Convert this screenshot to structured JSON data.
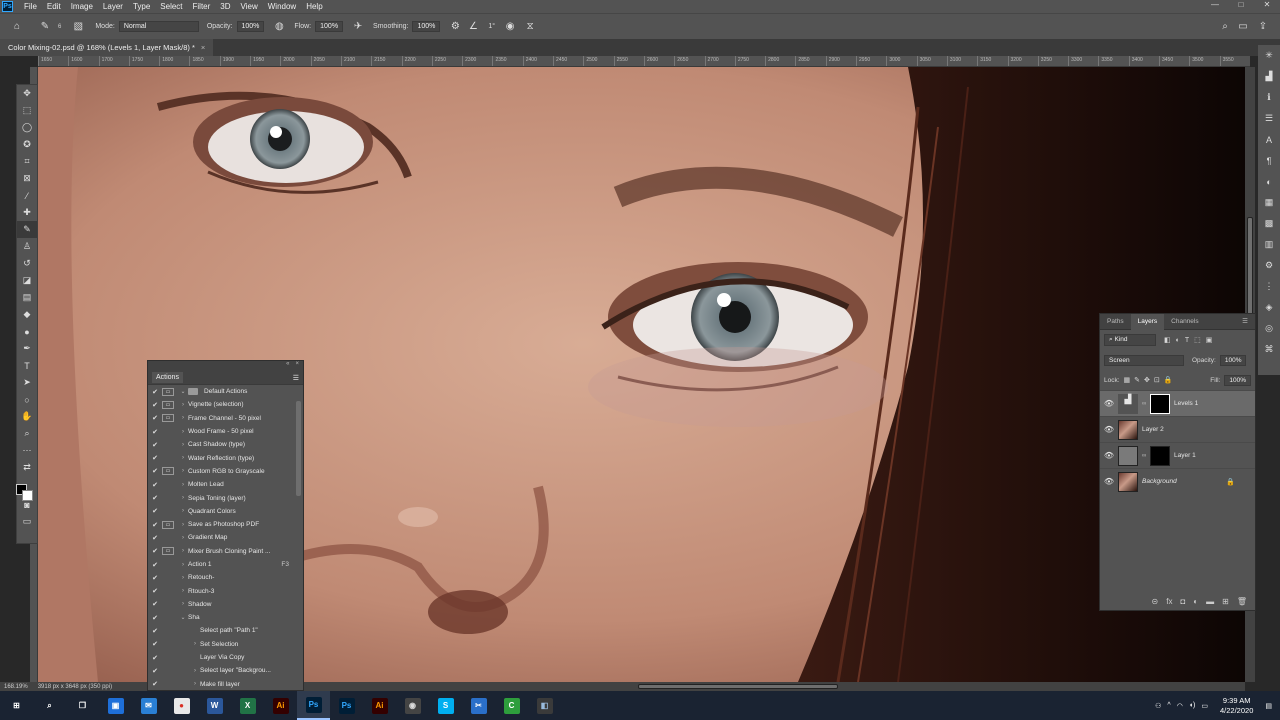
{
  "menubar": {
    "logo": "Ps",
    "items": [
      "File",
      "Edit",
      "Image",
      "Layer",
      "Type",
      "Select",
      "Filter",
      "3D",
      "View",
      "Window",
      "Help"
    ],
    "window_controls": [
      "—",
      "□",
      "✕"
    ]
  },
  "options": {
    "mode_label": "Mode:",
    "mode_value": "Normal",
    "opacity_label": "Opacity:",
    "opacity_value": "100%",
    "flow_label": "Flow:",
    "flow_value": "100%",
    "smoothing_label": "Smoothing:",
    "smoothing_value": "100%",
    "angle_value": "1°",
    "brush_size": "6"
  },
  "document": {
    "tab_title": "Color Mixing-02.psd @ 168% (Levels 1, Layer Mask/8) *",
    "close": "×"
  },
  "ruler_ticks": [
    "1650",
    "1600",
    "1700",
    "1750",
    "1800",
    "1850",
    "1900",
    "1950",
    "2000",
    "2050",
    "2100",
    "2150",
    "2200",
    "2250",
    "2300",
    "2350",
    "2400",
    "2450",
    "2500",
    "2550",
    "2600",
    "2650",
    "2700",
    "2750",
    "2800",
    "2850",
    "2900",
    "2950",
    "3000",
    "3050",
    "3100",
    "3150",
    "3200",
    "3250",
    "3300",
    "3350",
    "3400",
    "3450",
    "3500",
    "3550"
  ],
  "status": {
    "zoom": "168.19%",
    "doc_size": "3918 px x 3648 px (350 ppi)"
  },
  "actions_panel": {
    "title": "Actions",
    "rows": [
      {
        "label": "Default Actions",
        "dialog": true,
        "folder": true,
        "level": 0,
        "key": ""
      },
      {
        "label": "Vignette (selection)",
        "dialog": true,
        "level": 1,
        "key": ""
      },
      {
        "label": "Frame Channel - 50 pixel",
        "dialog": true,
        "level": 1,
        "key": ""
      },
      {
        "label": "Wood Frame - 50 pixel",
        "dialog": false,
        "level": 1,
        "key": ""
      },
      {
        "label": "Cast Shadow (type)",
        "dialog": false,
        "level": 1,
        "key": ""
      },
      {
        "label": "Water Reflection (type)",
        "dialog": false,
        "level": 1,
        "key": ""
      },
      {
        "label": "Custom RGB to Grayscale",
        "dialog": true,
        "level": 1,
        "key": ""
      },
      {
        "label": "Molten Lead",
        "dialog": false,
        "level": 1,
        "key": ""
      },
      {
        "label": "Sepia Toning (layer)",
        "dialog": false,
        "level": 1,
        "key": ""
      },
      {
        "label": "Quadrant Colors",
        "dialog": false,
        "level": 1,
        "key": ""
      },
      {
        "label": "Save as Photoshop PDF",
        "dialog": true,
        "level": 1,
        "key": ""
      },
      {
        "label": "Gradient Map",
        "dialog": false,
        "level": 1,
        "key": ""
      },
      {
        "label": "Mixer Brush Cloning Paint ...",
        "dialog": true,
        "level": 1,
        "key": ""
      },
      {
        "label": "Action 1",
        "dialog": false,
        "level": 1,
        "key": "F3"
      },
      {
        "label": "Retouch-",
        "dialog": false,
        "level": 1,
        "key": ""
      },
      {
        "label": "Rtouch-3",
        "dialog": false,
        "level": 1,
        "key": ""
      },
      {
        "label": "Shadow",
        "dialog": false,
        "level": 1,
        "key": ""
      },
      {
        "label": "Sha",
        "dialog": false,
        "level": 1,
        "key": "",
        "open": true
      },
      {
        "label": "Select path \"Path 1\"",
        "dialog": false,
        "level": 2,
        "key": "",
        "leaf": true
      },
      {
        "label": "Set Selection",
        "dialog": false,
        "level": 2,
        "key": ""
      },
      {
        "label": "Layer Via Copy",
        "dialog": false,
        "level": 2,
        "key": "",
        "leaf": true
      },
      {
        "label": "Select layer \"Backgrou...",
        "dialog": false,
        "level": 2,
        "key": ""
      },
      {
        "label": "Make fill layer",
        "dialog": false,
        "level": 2,
        "key": ""
      }
    ]
  },
  "layers_panel": {
    "tabs": [
      "Paths",
      "Layers",
      "Channels"
    ],
    "active_tab": "Layers",
    "filter": "Kind",
    "blend_mode": "Screen",
    "opacity_label": "Opacity:",
    "opacity_value": "100%",
    "lock_label": "Lock:",
    "fill_label": "Fill:",
    "fill_value": "100%",
    "layers": [
      {
        "name": "Levels 1",
        "kind": "adjustment",
        "active": true,
        "italic": false
      },
      {
        "name": "Layer 2",
        "kind": "photo",
        "active": false,
        "italic": false
      },
      {
        "name": "Layer 1",
        "kind": "gray-mask",
        "active": false,
        "italic": false
      },
      {
        "name": "Background",
        "kind": "photo",
        "active": false,
        "italic": true,
        "locked": true
      }
    ]
  },
  "taskbar": {
    "time": "9:39 AM",
    "date": "4/22/2020",
    "apps": [
      {
        "name": "start",
        "label": "⊞",
        "color": "#1a2332",
        "fg": "#fff"
      },
      {
        "name": "search",
        "label": "⌕",
        "color": "#1a2332",
        "fg": "#fff"
      },
      {
        "name": "task-view",
        "label": "❐",
        "color": "#1a2332",
        "fg": "#fff"
      },
      {
        "name": "store",
        "label": "▣",
        "color": "#1e6fd9",
        "fg": "#fff"
      },
      {
        "name": "mail",
        "label": "✉",
        "color": "#2a7fd4",
        "fg": "#fff"
      },
      {
        "name": "chrome",
        "label": "●",
        "color": "#e8e8e8",
        "fg": "#d93025"
      },
      {
        "name": "word",
        "label": "W",
        "color": "#2b579a",
        "fg": "#fff"
      },
      {
        "name": "excel",
        "label": "X",
        "color": "#217346",
        "fg": "#fff"
      },
      {
        "name": "illustrator",
        "label": "Ai",
        "color": "#330000",
        "fg": "#ff9a00"
      },
      {
        "name": "photoshop",
        "label": "Ps",
        "color": "#001e36",
        "fg": "#31a8ff",
        "active": true
      },
      {
        "name": "photoshop-2",
        "label": "Ps",
        "color": "#001e36",
        "fg": "#31a8ff"
      },
      {
        "name": "illustrator-2",
        "label": "Ai",
        "color": "#330000",
        "fg": "#ff9a00"
      },
      {
        "name": "browser",
        "label": "◉",
        "color": "#444",
        "fg": "#ddd"
      },
      {
        "name": "skype",
        "label": "S",
        "color": "#00aff0",
        "fg": "#fff"
      },
      {
        "name": "snip",
        "label": "✂",
        "color": "#2a6fc9",
        "fg": "#fff"
      },
      {
        "name": "camtasia",
        "label": "C",
        "color": "#2e9e3c",
        "fg": "#fff"
      },
      {
        "name": "recorder",
        "label": "◧",
        "color": "#3a3a3a",
        "fg": "#9bd"
      }
    ]
  }
}
